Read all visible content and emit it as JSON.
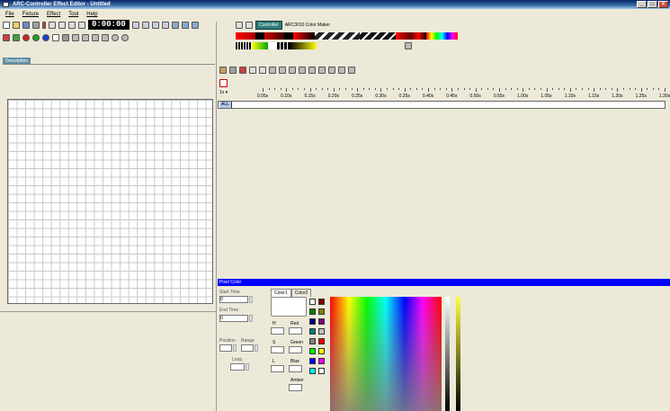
{
  "window": {
    "title": "ARC-Controller Effect Editor - Untitled"
  },
  "menu": [
    "File",
    "Fixture",
    "Effect",
    "Tool",
    "Help"
  ],
  "toolbar": {
    "time_display": "0:00:00",
    "controller_button": "Controller",
    "controller_name": "ARC3010 Color Maker"
  },
  "left": {
    "description_tab": "Description"
  },
  "timeline": {
    "zoom": "1x",
    "ticks": [
      "0.05s",
      "0.10s",
      "0.15s",
      "0.20s",
      "0.25s",
      "0.30s",
      "0.35s",
      "0.40s",
      "0.45s",
      "0.50s",
      "0.55s",
      "1.00s",
      "1.05s",
      "1.10s",
      "1.15s",
      "1.20s",
      "1.25s",
      "1.30s"
    ],
    "track_label": "ALL"
  },
  "pixel_color": {
    "title": "Pixel Color",
    "start_time_label": "Start Time",
    "start_time_value": "0",
    "end_time_label": "End Time",
    "end_time_value": "0",
    "position_label": "Position",
    "range_label": "Range",
    "loop_label": "Loop",
    "tabs": [
      "Color1",
      "Color2"
    ],
    "h_label": "H",
    "s_label": "S",
    "l_label": "L",
    "red_label": "Red",
    "green_label": "Green",
    "blue_label": "Blue",
    "amber_label": "Amber"
  },
  "swatch_colors": [
    "#ffffff",
    "#800000",
    "#008000",
    "#808000",
    "#000080",
    "#800080",
    "#008080",
    "#c0c0c0",
    "#808080",
    "#ff0000",
    "#00ff00",
    "#ffff00",
    "#0000ff",
    "#ff00ff",
    "#00ffff",
    "#ffffff"
  ]
}
